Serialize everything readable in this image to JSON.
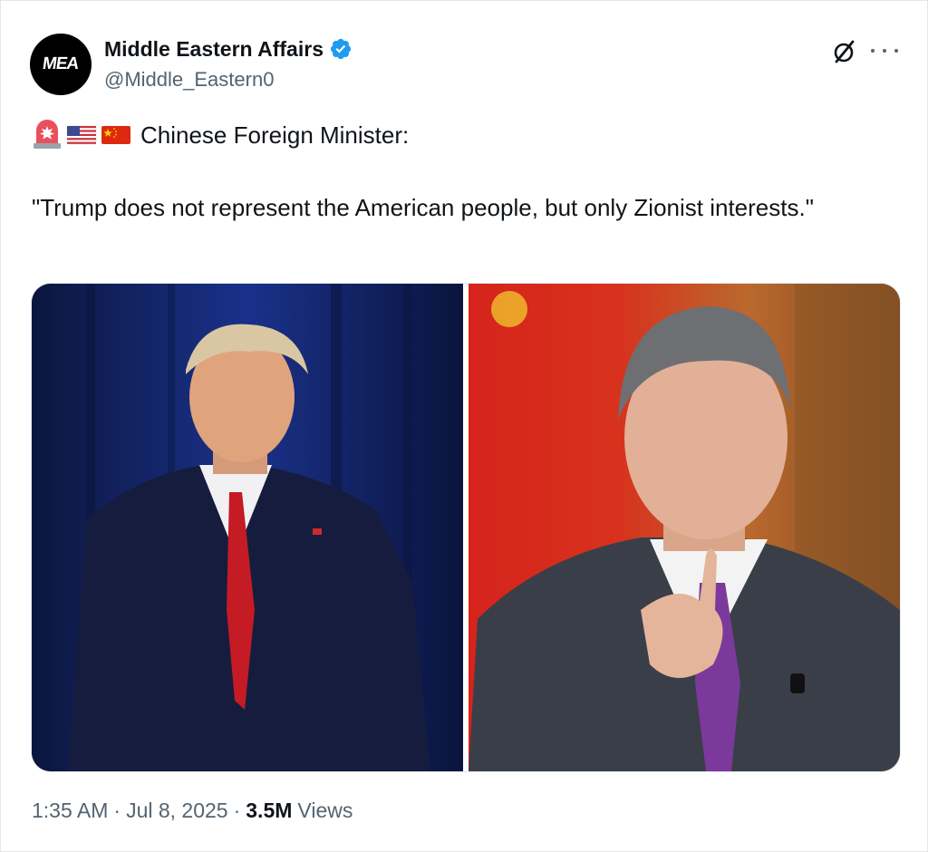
{
  "author": {
    "avatar_text": "MEA",
    "display_name": "Middle Eastern Affairs",
    "handle": "@Middle_Eastern0",
    "verified": true,
    "verified_color": "#1d9bf0"
  },
  "header_icons": [
    "grok-icon",
    "more-icon"
  ],
  "tweet": {
    "emojis": [
      "police-car-light-icon",
      "us-flag-icon",
      "china-flag-icon"
    ],
    "line1": "Chinese Foreign Minister:",
    "quote": "\"Trump does not represent the American people, but only Zionist interests.\""
  },
  "media": {
    "images": [
      "photo-trump",
      "photo-wang-yi"
    ]
  },
  "meta": {
    "time": "1:35 AM",
    "date": "Jul 8, 2025",
    "views_count": "3.5M",
    "views_label": "Views",
    "separator": "·"
  }
}
